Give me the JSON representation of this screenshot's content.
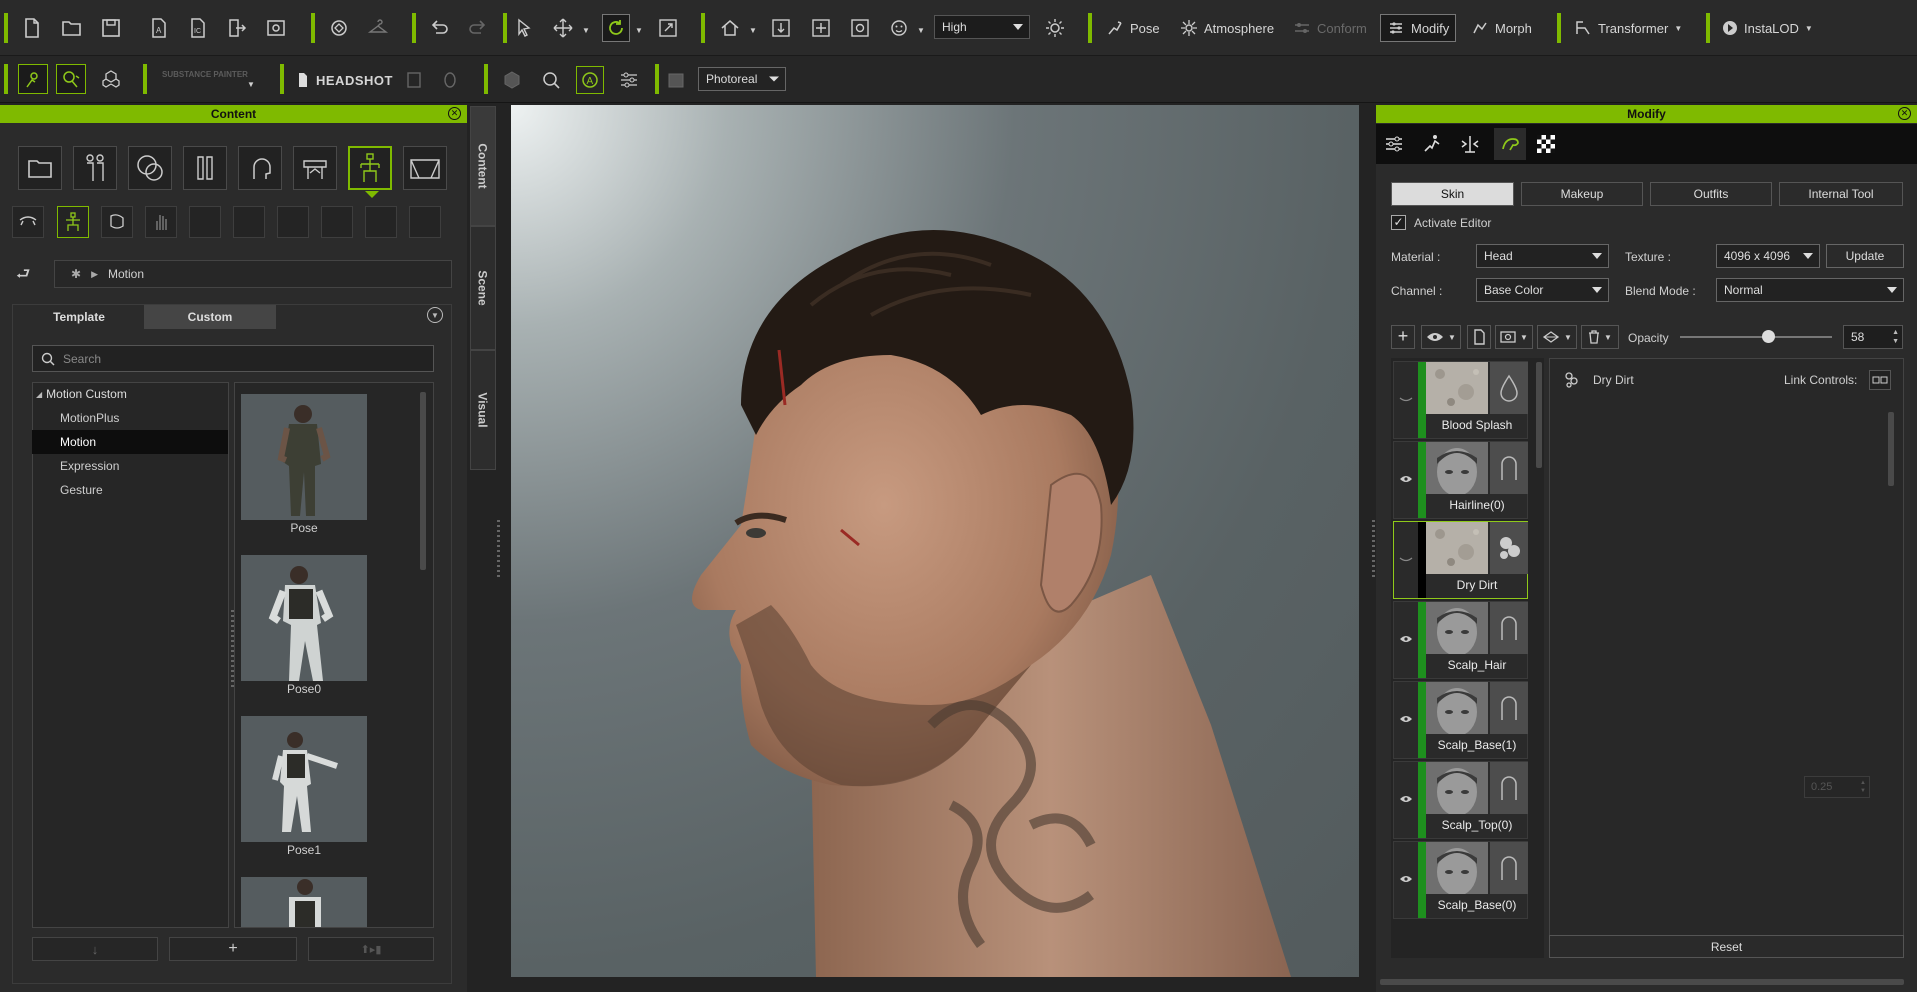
{
  "toolbar1": {
    "quality_select": "High",
    "pose_label": "Pose",
    "atmosphere_label": "Atmosphere",
    "conform_label": "Conform",
    "modify_label": "Modify",
    "morph_label": "Morph",
    "transformer_label": "Transformer",
    "instalod_label": "InstaLOD"
  },
  "toolbar2": {
    "substance_label": "SUBSTANCE PAINTER",
    "headshot_label": "HEADSHOT",
    "render_select": "Photoreal"
  },
  "content_panel": {
    "title": "Content",
    "breadcrumb": "Motion",
    "tabs": [
      "Template",
      "Custom"
    ],
    "active_tab": "Custom",
    "search_placeholder": "Search",
    "tree": {
      "root": "Motion Custom",
      "items": [
        "MotionPlus",
        "Motion",
        "Expression",
        "Gesture"
      ],
      "selected": "Motion"
    },
    "thumbnails": [
      "Pose",
      "Pose0",
      "Pose1"
    ]
  },
  "side_tabs": [
    "Content",
    "Scene",
    "Visual"
  ],
  "modify_panel": {
    "title": "Modify",
    "tabs": [
      "Skin",
      "Makeup",
      "Outfits",
      "Internal Tool"
    ],
    "active_tab": "Skin",
    "activate_editor_label": "Activate Editor",
    "activate_editor_checked": true,
    "material_label": "Material :",
    "material_value": "Head",
    "texture_label": "Texture :",
    "texture_value": "4096 x 4096",
    "update_label": "Update",
    "channel_label": "Channel :",
    "channel_value": "Base Color",
    "blend_label": "Blend Mode :",
    "blend_value": "Normal",
    "opacity_label": "Opacity",
    "opacity_value": "58",
    "opacity_fraction": 0.58,
    "layers": [
      {
        "name": "Blood Splash",
        "visible": false,
        "selected": false,
        "skin": "dirt"
      },
      {
        "name": "Hairline(0)",
        "visible": true,
        "selected": false,
        "skin": "head"
      },
      {
        "name": "Dry Dirt",
        "visible": false,
        "selected": true,
        "skin": "dirt"
      },
      {
        "name": "Scalp_Hair",
        "visible": true,
        "selected": false,
        "skin": "head"
      },
      {
        "name": "Scalp_Base(1)",
        "visible": true,
        "selected": false,
        "skin": "head"
      },
      {
        "name": "Scalp_Top(0)",
        "visible": true,
        "selected": false,
        "skin": "head"
      },
      {
        "name": "Scalp_Base(0)",
        "visible": true,
        "selected": false,
        "skin": "head"
      }
    ],
    "detail_title": "Dry Dirt",
    "link_controls_label": "Link Controls:",
    "spin_value": "0.25",
    "reset_label": "Reset"
  },
  "colors": {
    "accent": "#7fba00",
    "layer_bar": "#1e8f1e",
    "background": "#232323"
  }
}
